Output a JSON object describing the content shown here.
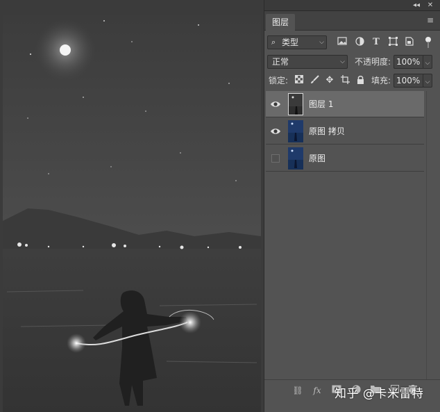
{
  "panel": {
    "collapse_icon": "double-chevron-left-icon",
    "close_icon": "close-icon",
    "tab_label": "图层",
    "menu_icon": "hamburger-menu-icon"
  },
  "filter": {
    "kind_value": "类型",
    "icons": [
      "image-filter-icon",
      "adjustment-filter-icon",
      "type-filter-icon",
      "shape-filter-icon",
      "smart-object-filter-icon",
      "filter-toggle-icon"
    ]
  },
  "blend": {
    "mode_value": "正常",
    "opacity_label": "不透明度:",
    "opacity_value": "100%"
  },
  "lock": {
    "label": "锁定:",
    "icons": [
      "lock-transparent-pixels-icon",
      "lock-image-pixels-icon",
      "lock-position-icon",
      "artboard-nesting-icon",
      "lock-all-icon"
    ],
    "fill_label": "填充:",
    "fill_value": "100%"
  },
  "layers": [
    {
      "name": "图层 1",
      "visible": true,
      "selected": true,
      "thumb": "grayscale"
    },
    {
      "name": "原图 拷贝",
      "visible": true,
      "selected": false,
      "thumb": "color"
    },
    {
      "name": "原图",
      "visible": false,
      "selected": false,
      "thumb": "color"
    }
  ],
  "bottom_icons": [
    "link-layers-icon",
    "fx-icon",
    "add-mask-icon",
    "adjustment-layer-icon",
    "group-folder-icon",
    "new-layer-icon",
    "trash-icon"
  ],
  "watermark": "知乎 @卡米雷特",
  "colors": {
    "panel_bg": "#535353",
    "selected_layer": "#6a6a6a",
    "canvas_bg": "#4a4a4a"
  }
}
